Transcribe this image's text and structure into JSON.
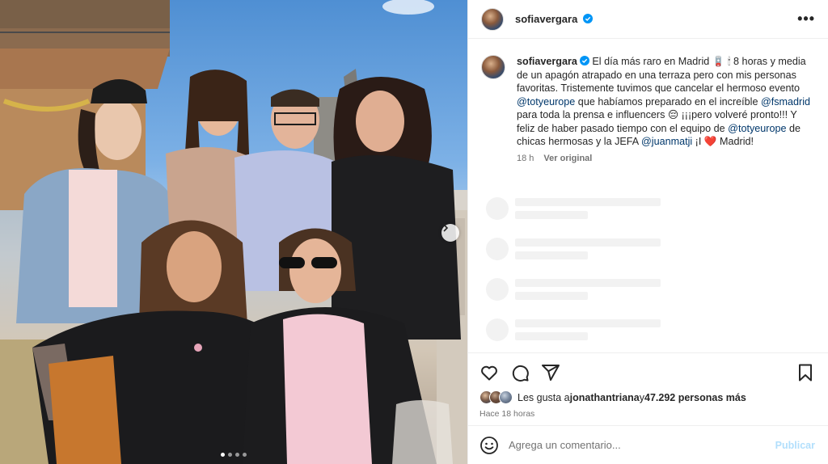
{
  "post": {
    "username": "sofiavergara",
    "caption": {
      "username": "sofiavergara",
      "seg1": "El día más raro en Madrid ",
      "emoji1": "🪫",
      "seg2": " 🕯 8 horas y media de un apagón atrapado en una terraza pero con mis personas favoritas. Tristemente tuvimos que cancelar el hermoso evento ",
      "mention1": "@totyeurope",
      "seg3": " que habíamos preparado en el increíble ",
      "mention2": "@fsmadrid",
      "seg4": " para toda la prensa e influencers ",
      "emoji2": "😔",
      "seg5": " ¡¡¡pero volveré pronto!!! Y feliz de haber pasado tiempo con el equipo de ",
      "mention3": "@totyeurope",
      "seg6": " de chicas hermosas y la JEFA ",
      "mention4": "@juanmatji",
      "seg7": " ¡I ",
      "emoji3": "❤️",
      "seg8": " Madrid!"
    },
    "time": "18 h",
    "see_original": "Ver original",
    "likes": {
      "prefix": "Les gusta a ",
      "first_user": "jonathantriana",
      "middle": " y ",
      "others": "47.292 personas más"
    },
    "posted_ago": "Hace 18 horas",
    "comment_placeholder": "Agrega un comentario...",
    "publish_label": "Publicar",
    "more_icon": "•••"
  },
  "media": {
    "carousel_dots": 4,
    "active_dot": 0
  },
  "icons": {
    "like": "heart-icon",
    "comment": "comment-icon",
    "share": "share-icon",
    "save": "bookmark-icon",
    "emoji": "emoji-icon",
    "verified": "verified-badge-icon",
    "next": "chevron-right-icon"
  },
  "colors": {
    "verified": "#0095f6",
    "mention": "#00376b",
    "publish_disabled": "#b2dffc",
    "muted": "#737373"
  }
}
